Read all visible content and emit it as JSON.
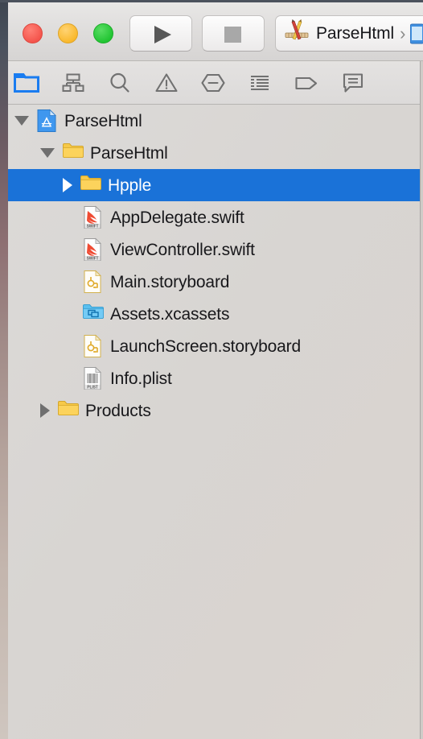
{
  "window": {
    "app": "Xcode",
    "traffic_lights": [
      {
        "name": "close",
        "color": "#f4544c"
      },
      {
        "name": "minimize",
        "color": "#f9b82c"
      },
      {
        "name": "maximize",
        "color": "#21c432"
      }
    ]
  },
  "toolbar": {
    "run_button": {
      "label": "Run",
      "icon": "play-icon",
      "enabled": true
    },
    "stop_button": {
      "label": "Stop",
      "icon": "stop-icon",
      "enabled": false
    },
    "scheme": {
      "icon": "xcode-project-icon",
      "name": "ParseHtml",
      "separator": "›",
      "destination_icon": "ios-device-icon"
    }
  },
  "navigator_tabs": {
    "selected": "project-navigator",
    "items": [
      {
        "name": "project-navigator",
        "icon": "folder-icon",
        "active": true
      },
      {
        "name": "symbol-navigator",
        "icon": "hierarchy-icon",
        "active": false
      },
      {
        "name": "find-navigator",
        "icon": "search-icon",
        "active": false
      },
      {
        "name": "issue-navigator",
        "icon": "warning-triangle-icon",
        "active": false
      },
      {
        "name": "test-navigator",
        "icon": "breakpoint-diamond-icon",
        "active": false
      },
      {
        "name": "report-navigator",
        "icon": "report-lines-icon",
        "active": false
      },
      {
        "name": "tag-navigator",
        "icon": "tag-icon",
        "active": false
      },
      {
        "name": "comment-navigator",
        "icon": "speech-bubble-icon",
        "active": false
      }
    ],
    "accent_color": "#1a7cf0"
  },
  "file_tree": {
    "selection_color": "#1a72d8",
    "rows": [
      {
        "label": "ParseHtml",
        "icon": "xcode-project-file-icon",
        "depth": 0,
        "twisty": "open",
        "selected": false
      },
      {
        "label": "ParseHtml",
        "icon": "folder-yellow-icon",
        "depth": 1,
        "twisty": "open",
        "selected": false
      },
      {
        "label": "Hpple",
        "icon": "folder-yellow-icon",
        "depth": 2,
        "twisty": "closed",
        "selected": true
      },
      {
        "label": "AppDelegate.swift",
        "icon": "swift-file-icon",
        "depth": 3,
        "twisty": "none",
        "selected": false
      },
      {
        "label": "ViewController.swift",
        "icon": "swift-file-icon",
        "depth": 3,
        "twisty": "none",
        "selected": false
      },
      {
        "label": "Main.storyboard",
        "icon": "storyboard-file-icon",
        "depth": 3,
        "twisty": "none",
        "selected": false
      },
      {
        "label": "Assets.xcassets",
        "icon": "xcassets-folder-icon",
        "depth": 3,
        "twisty": "none",
        "selected": false
      },
      {
        "label": "LaunchScreen.storyboard",
        "icon": "storyboard-file-icon",
        "depth": 3,
        "twisty": "none",
        "selected": false
      },
      {
        "label": "Info.plist",
        "icon": "plist-file-icon",
        "depth": 3,
        "twisty": "none",
        "selected": false
      },
      {
        "label": "Products",
        "icon": "folder-yellow-icon",
        "depth": 1,
        "twisty": "closed",
        "selected": false
      }
    ]
  }
}
